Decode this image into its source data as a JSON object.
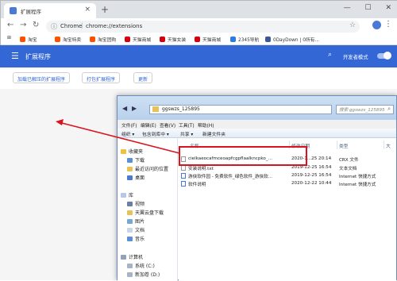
{
  "browser": {
    "tab_title": "扩展程序",
    "tab_close": "×",
    "new_tab": "+",
    "window_controls": [
      "—",
      "☐",
      "✕"
    ],
    "omnibox": {
      "host": "Chrome",
      "sep": "|",
      "path": "chrome://extensions"
    },
    "bookmarks": [
      {
        "label": "淘宝",
        "color": "#ff5000"
      },
      {
        "label": "淘宝特卖",
        "color": "#ff5000"
      },
      {
        "label": "淘宝团购",
        "color": "#ff5000"
      },
      {
        "label": "天猫商城",
        "color": "#d4000f"
      },
      {
        "label": "天猫女装",
        "color": "#d4000f"
      },
      {
        "label": "天猫商城",
        "color": "#d4000f"
      },
      {
        "label": "2345导航",
        "color": "#2b7be5"
      },
      {
        "label": "0DayDown | 0所有...",
        "color": "#3b5998"
      }
    ]
  },
  "extensions": {
    "title": "扩展程序",
    "dev_mode_label": "开发者模式",
    "dev_mode_on": true,
    "buttons": [
      "加载已解压的扩展程序",
      "打包扩展程序",
      "更新"
    ]
  },
  "explorer": {
    "path": "ggswzs_125895",
    "search_placeholder": "搜索 ggswzs_125895",
    "menu": [
      "文件(F)",
      "编辑(E)",
      "查看(V)",
      "工具(T)",
      "帮助(H)"
    ],
    "commands": [
      "组织 ▾",
      "包含到库中 ▾",
      "共享 ▾",
      "新建文件夹"
    ],
    "nav": {
      "favorites": "收藏夹",
      "favorites_items": [
        "下载",
        "最近访问的位置",
        "桌面"
      ],
      "libraries": "库",
      "library_items": [
        "视频",
        "天翼云盘下载",
        "图片",
        "文档",
        "音乐"
      ],
      "computer": "计算机",
      "drives": [
        "系统 (C:)",
        "新加卷 (D:)"
      ]
    },
    "columns": [
      "名称",
      "修改日期",
      "类型",
      "大"
    ],
    "files": [
      {
        "name": "cielkaeocafmceoapfcgpflaalkncpko_...",
        "date": "2020-1...25 20:14",
        "type": "CRX 文件"
      },
      {
        "name": "安装说明.txt",
        "date": "2019-12-25 16:54",
        "type": "文本文档"
      },
      {
        "name": "游侠软件园 - 免费软件_绿色软件_游侠软...",
        "date": "2019-12-25 16:54",
        "type": "Internet 快捷方式"
      },
      {
        "name": "软件说明",
        "date": "2020-12-22 10:44",
        "type": "Internet 快捷方式"
      }
    ]
  },
  "colors": {
    "accent": "#3367d6",
    "highlight": "#d9141e",
    "arrow": "#d9141e"
  }
}
